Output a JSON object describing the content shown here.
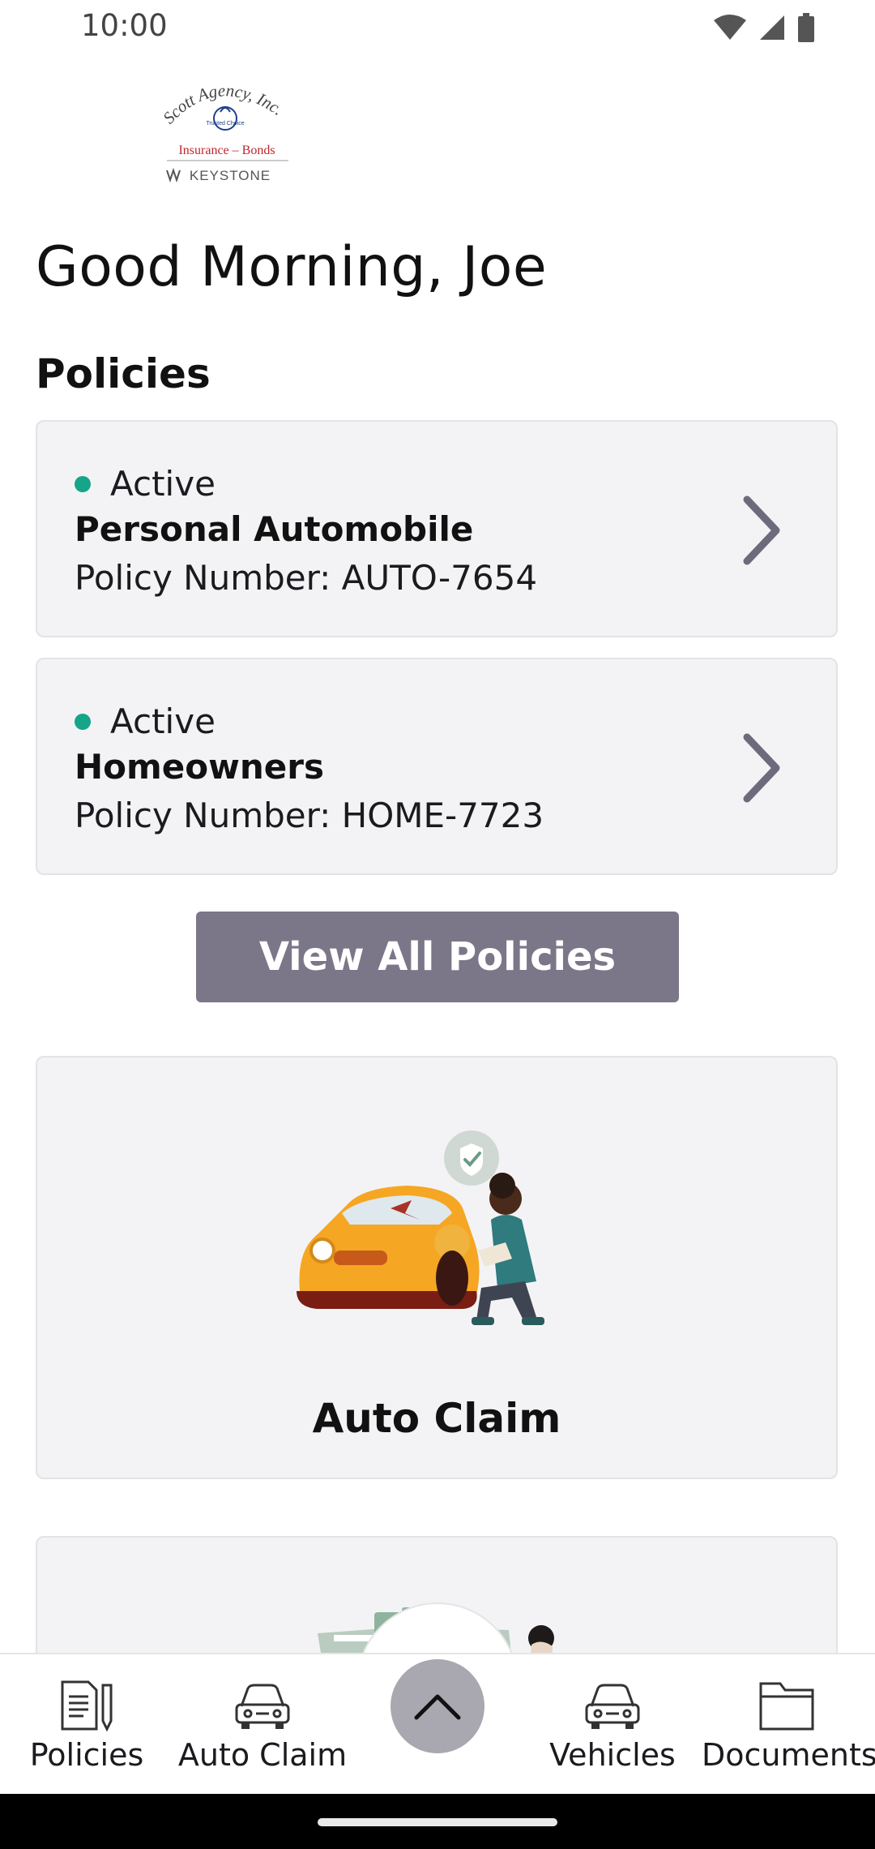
{
  "status_bar": {
    "time": "10:00",
    "icons": [
      "wifi-icon",
      "cell-signal-icon",
      "battery-icon"
    ]
  },
  "logo": {
    "line1": "Scott Agency, Inc.",
    "badge": "Trusted Choice",
    "line2": "Insurance – Bonds",
    "line3": "KEYSTONE"
  },
  "greeting": "Good Morning, Joe",
  "policies": {
    "title": "Policies",
    "items": [
      {
        "status": "Active",
        "name": "Personal Automobile",
        "number": "Policy Number: AUTO-7654"
      },
      {
        "status": "Active",
        "name": "Homeowners",
        "number": "Policy Number: HOME-7723"
      }
    ],
    "view_all_label": "View All Policies"
  },
  "features": [
    {
      "title": "Auto Claim",
      "illustration": "car-damage-inspection-illustration"
    },
    {
      "title": "",
      "illustration": "home-claim-illustration"
    }
  ],
  "bottom_nav": {
    "items": [
      {
        "label": "Policies",
        "icon": "policy-document-icon"
      },
      {
        "label": "Auto Claim",
        "icon": "car-icon"
      },
      {
        "label": "Vehicles",
        "icon": "car-icon"
      },
      {
        "label": "Documents",
        "icon": "folder-icon"
      }
    ],
    "fab_icon": "chevron-up-icon"
  },
  "colors": {
    "active_status": "#16a589",
    "button": "#7b7789",
    "card_bg": "#f3f3f5",
    "chevron": "#6e6a7c",
    "fab": "#a9a7b0"
  }
}
